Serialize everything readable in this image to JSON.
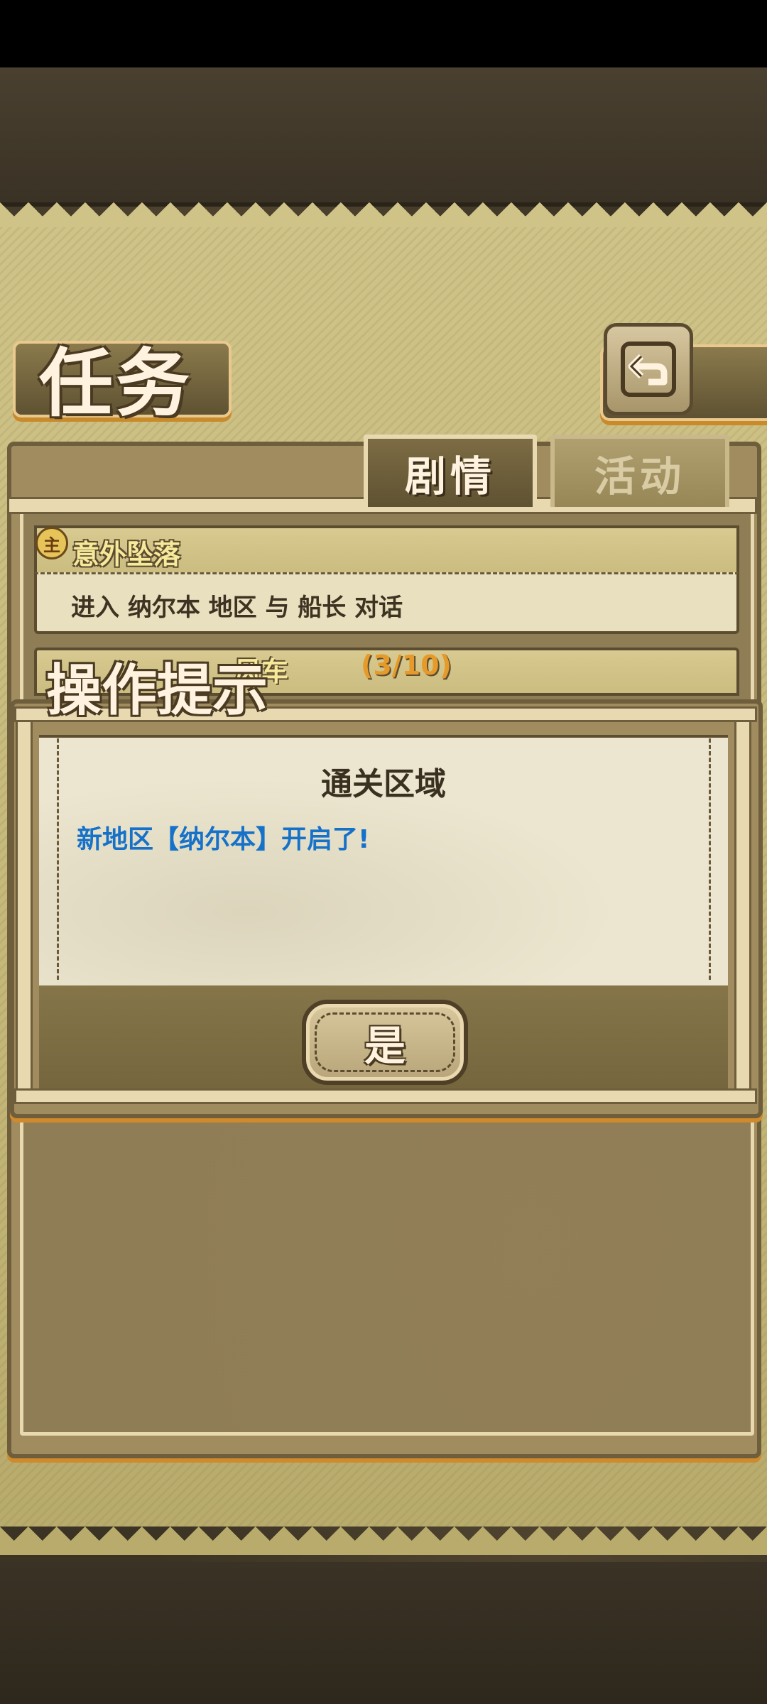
{
  "screen": {
    "title": "任务",
    "back_icon": "return-arrow-icon"
  },
  "tabs": [
    {
      "label": "剧情",
      "active": true
    },
    {
      "label": "活动",
      "active": false
    }
  ],
  "quests": [
    {
      "badge": "主",
      "title": "意外坠落",
      "description": "进入 纳尔本 地区 与 船长 对话"
    },
    {
      "title_partial": "风车",
      "progress": "(3/10)"
    }
  ],
  "dialog": {
    "heading": "操作提示",
    "title": "通关区域",
    "message": "新地区【纳尔本】开启了!",
    "confirm_label": "是"
  },
  "colors": {
    "accent_orange": "#d08a2e",
    "message_blue": "#1672c9",
    "parchment": "#cfc388",
    "frame_dark": "#6e5e3c"
  }
}
